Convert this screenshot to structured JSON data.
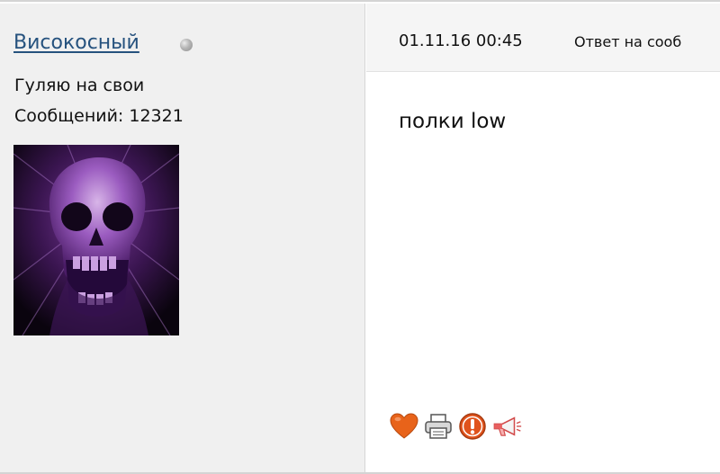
{
  "sidebar": {
    "username": "Високосный",
    "user_title": "Гуляю на свои",
    "post_count": "Сообщений: 12321",
    "status": "offline"
  },
  "post": {
    "date": "01.11.16 00:45",
    "reply_label": "Ответ на сооб",
    "body": "полки low"
  },
  "actions": {
    "icons": [
      "heart-icon",
      "printer-icon",
      "warning-icon",
      "megaphone-icon"
    ]
  },
  "colors": {
    "username": "#26527e",
    "sidebar_bg": "#f0f0f0",
    "header_bg": "#f5f5f5",
    "heart": "#e8631a",
    "warning": "#e0531c"
  }
}
